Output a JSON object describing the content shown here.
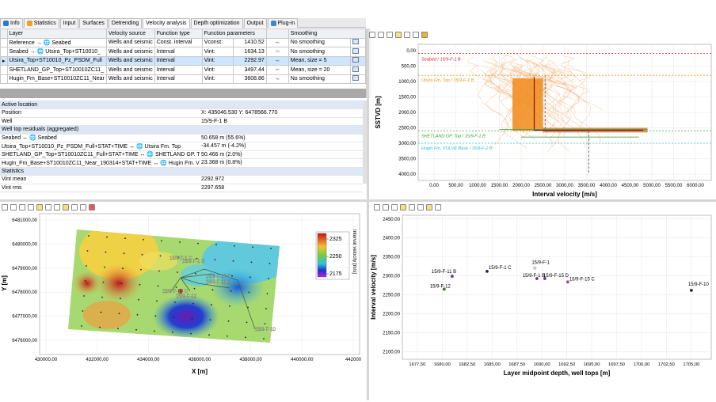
{
  "tabs": [
    "Info",
    "Statistics",
    "Input",
    "Surfaces",
    "Detrending",
    "Velocity analysis",
    "Depth optimization",
    "Output",
    "Plug-in"
  ],
  "active_tab": "Velocity analysis",
  "layers_table": {
    "headers": [
      "Layer",
      "Velocity source",
      "Function type",
      "Function parameters",
      "",
      "Smoothing",
      ""
    ],
    "rows": [
      {
        "layer": "Reference → 🌐 Seabed",
        "source": "Wells and seismic",
        "ftype": "Const. interval",
        "param": "Vconst:",
        "value": "1410.52",
        "smoothing": "No smoothing"
      },
      {
        "layer": "Seabed → 🌐 Utsira_Top+ST10010_",
        "source": "Wells and seismic",
        "ftype": "Interval",
        "param": "Vint:",
        "value": "1634.13",
        "smoothing": "No smoothing"
      },
      {
        "layer": "Utsira_Top+ST10010_Pz_PSDM_Full",
        "source": "Wells and seismic",
        "ftype": "Interval",
        "param": "Vint:",
        "value": "2292.97",
        "smoothing": "Mean, size = 5"
      },
      {
        "layer": "SHETLAND_GP_Top+ST10010ZC11_",
        "source": "Wells and seismic",
        "ftype": "Interval",
        "param": "Vint:",
        "value": "3497.44",
        "smoothing": "Mean, size = 20"
      },
      {
        "layer": "Hugin_Fm_Base+ST10010ZC11_Near",
        "source": "Wells and seismic",
        "ftype": "Interval",
        "param": "Vint:",
        "value": "3608.86",
        "smoothing": "No smoothing"
      }
    ]
  },
  "info_panel": {
    "title": "Active location",
    "position_label": "Position",
    "position_value": "X: 435046.530  Y: 6478566.770",
    "well_label": "Well",
    "well_value": "15/9-F-1 B",
    "residuals_title": "Well top residuals (aggregated)",
    "residuals": [
      {
        "label": "Seabed ↔ 🌐 Seabed",
        "value": "50.658 m (55.6%)"
      },
      {
        "label": "Utsira_Top+ST10010_Pz_PSDM_Full+STAT+TIME ↔ 🌐 Utsira Fm. Top",
        "value": "-34.457 m (-4.2%)"
      },
      {
        "label": "SHETLAND_GP_Top+ST10010ZC11_Full+STAT+TIME ↔ 🌐 SHETLAND GP. Top",
        "value": "50.466 m (2.0%)"
      },
      {
        "label": "Hugin_Fm_Base+ST10010ZC11_Near_190314+STAT+TIME ↔ 🌐 Hugin Fm. VOLVE Base",
        "value": "23.368 m (0.8%)"
      }
    ],
    "statistics_title": "Statistics",
    "stats": [
      {
        "label": "Vint mean",
        "value": "2292.972"
      },
      {
        "label": "Vint rms",
        "value": "2297.658"
      }
    ]
  },
  "tr_chart": {
    "ylabel": "SSTVD [m]",
    "xlabel": "Interval velocity [m/s]",
    "yticks": [
      "0,00",
      "500,00",
      "1000,00",
      "1500,00",
      "2000,00",
      "2500,00",
      "3000,00",
      "3500,00",
      "4000,00"
    ],
    "xticks": [
      "0,00",
      "500,00",
      "1000,00",
      "1500,00",
      "2000,00",
      "2500,00",
      "3000,00",
      "3500,00",
      "4000,00",
      "4500,00",
      "5000,00",
      "5500,00",
      "6000,00"
    ],
    "horizon_labels": [
      "Seabed / 15/9-F-1 B",
      "Utsira Fm. Top / 15/9-F-1 B",
      "SHETLAND GP. Top / 15/9-F-1 B",
      "Hugin Fm. VOLVE Base / 15/9-F-1 B"
    ]
  },
  "map_chart": {
    "ylabel": "Y [m]",
    "xlabel": "X [m]",
    "yticks": [
      "6481000,00",
      "6480000,00",
      "6479000,00",
      "6478000,00",
      "6477000,00",
      "6476000,00"
    ],
    "xticks": [
      "430000,00",
      "432000,00",
      "434000,00",
      "436000,00",
      "438000,00",
      "440000,00",
      "442000"
    ],
    "colorbar_label": "Interval velocity [m/s]",
    "colorbar_ticks": [
      "2325",
      "2250",
      "2175"
    ],
    "well_labels": [
      "15/9-F-1 C",
      "15/9-F-1 B",
      "15/9-F-15 D",
      "15/9-F-11 B",
      "15/9-F-12",
      "15/9-F-15 C",
      "15/9-F-10"
    ]
  },
  "scatter_chart": {
    "ylabel": "Interval velocity [m/s]",
    "xlabel": "Layer midpoint depth, well tops [m]",
    "yticks": [
      "2450,00",
      "2400,00",
      "2350,00",
      "2300,00",
      "2250,00",
      "2200,00",
      "2150,00",
      "2100,00"
    ],
    "xticks": [
      "1677,50",
      "1680,00",
      "1682,50",
      "1685,00",
      "1687,50",
      "1690,00",
      "1692,50",
      "1695,00",
      "1697,50",
      "1700,00",
      "1702,50",
      "1705,00"
    ],
    "points": [
      {
        "label": "15/9-F-11 B",
        "x": 1681.0,
        "y": 2299,
        "color": "#7b2a8a"
      },
      {
        "label": "15/9-F-1 C",
        "x": 1684.5,
        "y": 2312,
        "color": "#1f1f5e"
      },
      {
        "label": "15/9-F-12",
        "x": 1680.2,
        "y": 2265,
        "color": "#2e7d32"
      },
      {
        "label": "15/9-F-1",
        "x": 1689.3,
        "y": 2321,
        "color": "#d9d9d9"
      },
      {
        "label": "15/9-F-1 B",
        "x": 1689.5,
        "y": 2293,
        "color": "#7b2a8a"
      },
      {
        "label": "15/9-F-15 D",
        "x": 1690.3,
        "y": 2293,
        "color": "#7b2a8a"
      },
      {
        "label": "15/9-F-15 C",
        "x": 1692.6,
        "y": 2284,
        "color": "#a64ca6"
      },
      {
        "label": "15/9-F-10",
        "x": 1705.0,
        "y": 2262,
        "color": "#1f1f5e"
      }
    ],
    "xlim": [
      1676,
      1707
    ],
    "ylim": [
      2080,
      2460
    ]
  }
}
